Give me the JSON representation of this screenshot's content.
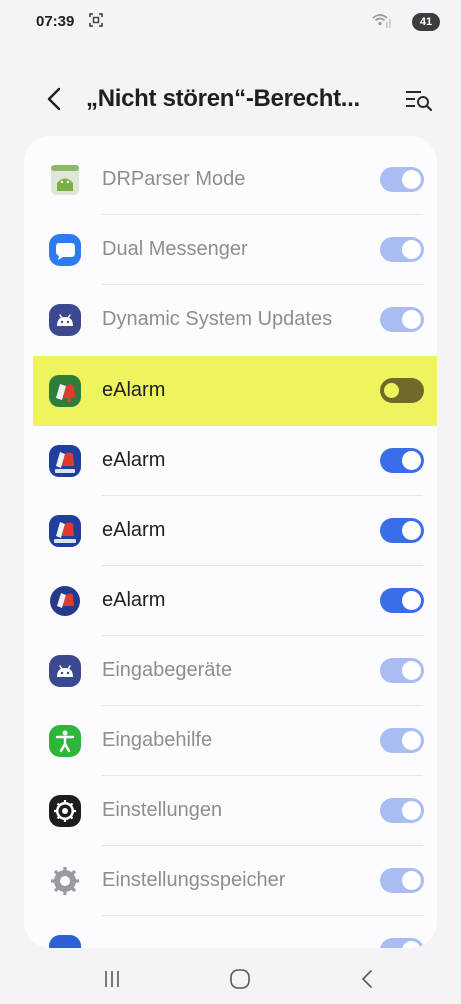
{
  "status_bar": {
    "time": "07:39",
    "battery": "41"
  },
  "header": {
    "title": "„Nicht stören“-Berecht..."
  },
  "apps": [
    {
      "name": "DRParser Mode",
      "icon": "drparser-icon",
      "toggle": "on-disabled"
    },
    {
      "name": "Dual Messenger",
      "icon": "dual-messenger-icon",
      "toggle": "on-disabled"
    },
    {
      "name": "Dynamic System Updates",
      "icon": "android-icon",
      "toggle": "on-disabled"
    },
    {
      "name": "eAlarm",
      "icon": "ealarm-icon",
      "toggle": "off",
      "highlighted": true
    },
    {
      "name": "eAlarm",
      "icon": "ealarm-icon",
      "toggle": "on"
    },
    {
      "name": "eAlarm",
      "icon": "ealarm-connect-icon",
      "toggle": "on"
    },
    {
      "name": "eAlarm",
      "icon": "ealarm-round-icon",
      "toggle": "on"
    },
    {
      "name": "Eingabegeräte",
      "icon": "android-icon",
      "toggle": "on-disabled"
    },
    {
      "name": "Eingabehilfe",
      "icon": "accessibility-icon",
      "toggle": "on-disabled"
    },
    {
      "name": "Einstellungen",
      "icon": "settings-gear-icon",
      "toggle": "on-disabled"
    },
    {
      "name": "Einstellungsspeicher",
      "icon": "settings-storage-icon",
      "toggle": "on-disabled"
    }
  ],
  "colors": {
    "toggle_on": "#3a6ee9",
    "toggle_on_disabled": "#a9bdf2",
    "highlight": "#eef45e"
  }
}
